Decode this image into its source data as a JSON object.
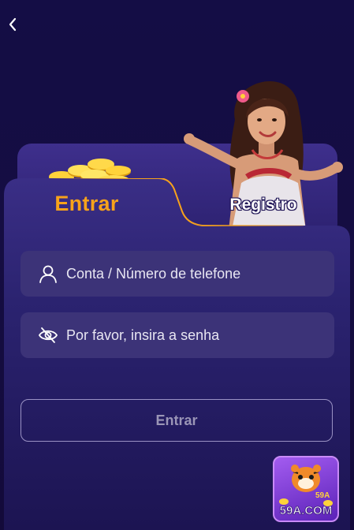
{
  "header": {
    "back_icon": "chevron-left-icon"
  },
  "tabs": {
    "active": "Entrar",
    "inactive": "Registro"
  },
  "form": {
    "account": {
      "placeholder": "Conta / Número de telefone",
      "icon": "user-icon"
    },
    "password": {
      "placeholder": "Por favor, insira a senha",
      "icon": "eye-off-icon"
    },
    "submit_label": "Entrar"
  },
  "logo": {
    "line1": "59A",
    "line2": "59A.COM"
  },
  "colors": {
    "background": "#140d45",
    "panel": "#2a2268",
    "input": "#3c3378",
    "accent": "#f7a21b",
    "tab_active_text": "#f7a21b",
    "tab_inactive_text": "#ffffff"
  }
}
